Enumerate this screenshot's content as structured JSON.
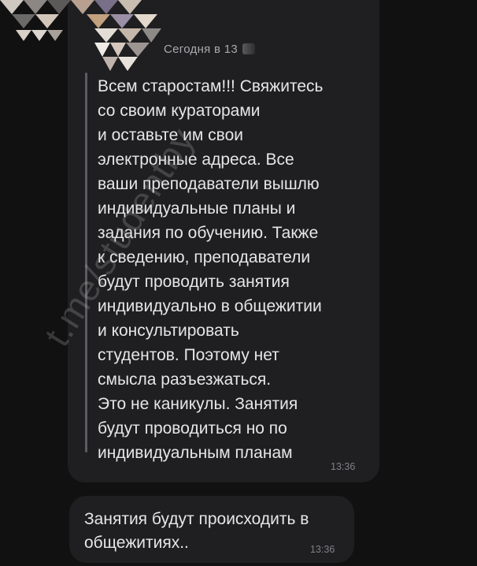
{
  "forwarded_message": {
    "sender_time": "Сегодня в 13",
    "text": "Всем старостам!!! Свяжитесь\nсо своим кураторами\nи оставьте им  свои\nэлектронные адреса. Все\nваши преподаватели вышлю\nиндивидуальные планы и\nзадания по обучению. Также\nк сведению, преподаватели\nбудут проводить занятия\nиндивидуально в общежитии\nи консультировать\nстудентов. Поэтому нет\nсмысла разъезжаться.\nЭто не каникулы. Занятия\nбудут проводиться но по\nиндивидуальным планам",
    "time": "13:36"
  },
  "second_message": {
    "text": "Занятия будут происходить в\nобщежитиях..",
    "time": "13:36"
  },
  "watermark": "t.me/studentby",
  "colors": {
    "background": "#111111",
    "bubble": "#1f1f21",
    "text": "#e6e6e9",
    "meta_text": "#808086"
  }
}
